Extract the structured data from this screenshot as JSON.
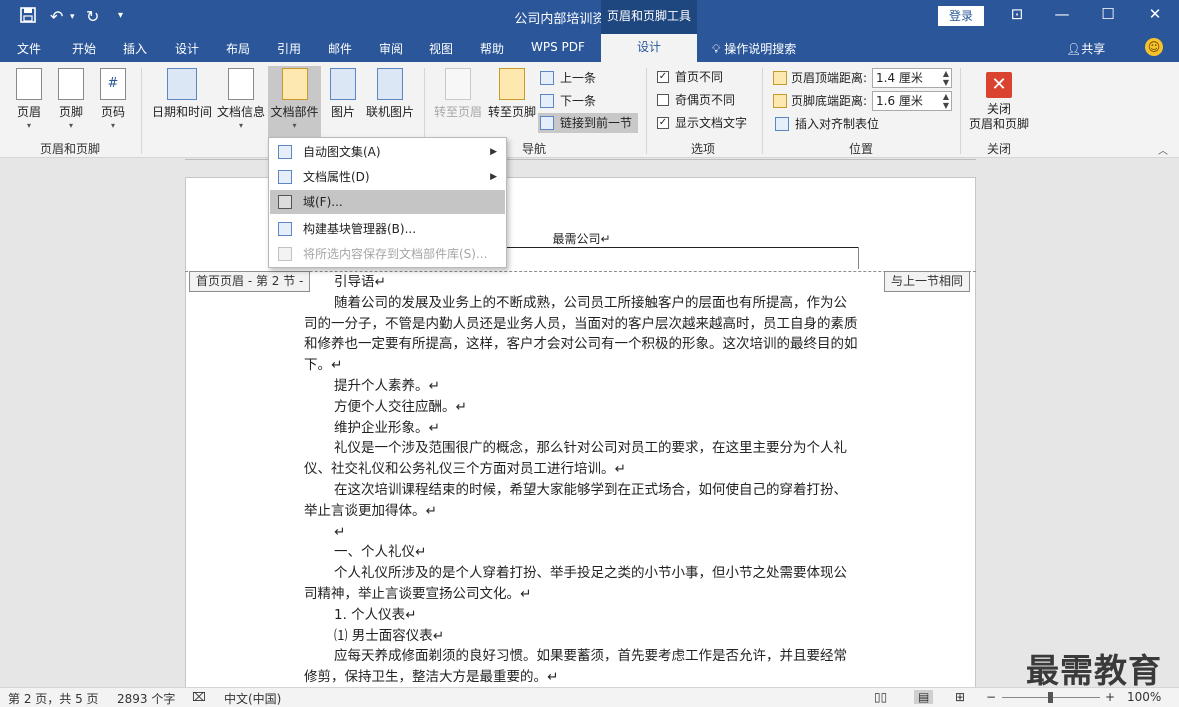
{
  "titlebar": {
    "title": "公司内部培训资料 - Word",
    "tools_tab": "页眉和页脚工具",
    "login": "登录",
    "save_icon": "save-icon",
    "undo_icon": "undo-icon",
    "redo_icon": "redo-icon",
    "customize_icon": "customize-icon"
  },
  "menu": {
    "tabs": [
      "文件",
      "开始",
      "插入",
      "设计",
      "布局",
      "引用",
      "邮件",
      "审阅",
      "视图",
      "帮助",
      "WPS PDF",
      "设计"
    ],
    "tell": "操作说明搜索",
    "share": "共享"
  },
  "ribbon": {
    "hf_group": {
      "label": "页眉和页脚",
      "header": "页眉",
      "footer": "页脚",
      "page_number": "页码"
    },
    "insert_group": {
      "date_time": "日期和时间",
      "doc_info": "文档信息",
      "quick_parts": "文档部件",
      "picture": "图片",
      "online_picture": "联机图片"
    },
    "nav_group": {
      "label": "导航",
      "goto_header": "转至页眉",
      "goto_footer": "转至页脚",
      "previous": "上一条",
      "next": "下一条",
      "link_previous": "链接到前一节"
    },
    "options_group": {
      "label": "选项",
      "different_first": "首页不同",
      "different_odd_even": "奇偶页不同",
      "show_doc_text": "显示文档文字",
      "different_first_checked": true,
      "different_odd_even_checked": false,
      "show_doc_text_checked": true
    },
    "position_group": {
      "label": "位置",
      "header_top": "页眉顶端距离:",
      "header_top_value": "1.4 厘米",
      "footer_bottom": "页脚底端距离:",
      "footer_bottom_value": "1.6 厘米",
      "insert_align_tab": "插入对齐制表位"
    },
    "close_group": {
      "label": "关闭",
      "close_line1": "关闭",
      "close_line2": "页眉和页脚"
    }
  },
  "dropdown": {
    "items": [
      {
        "label": "自动图文集(A)",
        "submenu": true,
        "highlighted": false,
        "disabled": false
      },
      {
        "label": "文档属性(D)",
        "submenu": true,
        "highlighted": false,
        "disabled": false
      },
      {
        "label": "域(F)...",
        "submenu": false,
        "highlighted": true,
        "disabled": false
      },
      {
        "label": "构建基块管理器(B)...",
        "submenu": false,
        "highlighted": false,
        "disabled": false
      },
      {
        "label": "将所选内容保存到文档部件库(S)...",
        "submenu": false,
        "highlighted": false,
        "disabled": true
      }
    ]
  },
  "document": {
    "header_text": "最需公司↵",
    "header_tag": "首页页眉 - 第 2 节 -",
    "same_as_prev_tag": "与上一节相同",
    "paragraphs": [
      {
        "text": "引导语↵",
        "indent": true
      },
      {
        "text": "随着公司的发展及业务上的不断成熟，公司员工所接触客户的层面也有所提高，作为公司的一分子，不管是内勤人员还是业务人员，当面对的客户层次越来越高时，员工自身的素质和修养也一定要有所提高，这样，客户才会对公司有一个积极的形象。这次培训的最终目的如下。↵",
        "indent": true
      },
      {
        "text": "提升个人素养。↵",
        "indent": true
      },
      {
        "text": "方便个人交往应酬。↵",
        "indent": true
      },
      {
        "text": "维护企业形象。↵",
        "indent": true
      },
      {
        "text": "礼仪是一个涉及范围很广的概念，那么针对公司对员工的要求，在这里主要分为个人礼仪、社交礼仪和公务礼仪三个方面对员工进行培训。↵",
        "indent": true
      },
      {
        "text": "在这次培训课程结束的时候，希望大家能够学到在正式场合，如何使自己的穿着打扮、举止言谈更加得体。↵",
        "indent": true
      },
      {
        "text": "↵",
        "indent": true
      },
      {
        "text": "一、个人礼仪↵",
        "indent": true
      },
      {
        "text": "个人礼仪所涉及的是个人穿着打扮、举手投足之类的小节小事，但小节之处需要体现公司精神，举止言谈要宣扬公司文化。↵",
        "indent": true
      },
      {
        "text": "1.  个人仪表↵",
        "indent": true
      },
      {
        "text": "⑴ 男士面容仪表↵",
        "indent": true
      },
      {
        "text": "应每天养成修面剃须的良好习惯。如果要蓄须，首先要考虑工作是否允许，并且要经常修剪，保持卫生，整洁大方是最重要的。↵",
        "indent": true
      }
    ]
  },
  "status": {
    "page": "第 2 页，共 5 页",
    "words": "2893 个字",
    "language": "中文(中国)",
    "zoom": "100%",
    "zoom_level": 1.0
  },
  "watermark": "最需教育"
}
